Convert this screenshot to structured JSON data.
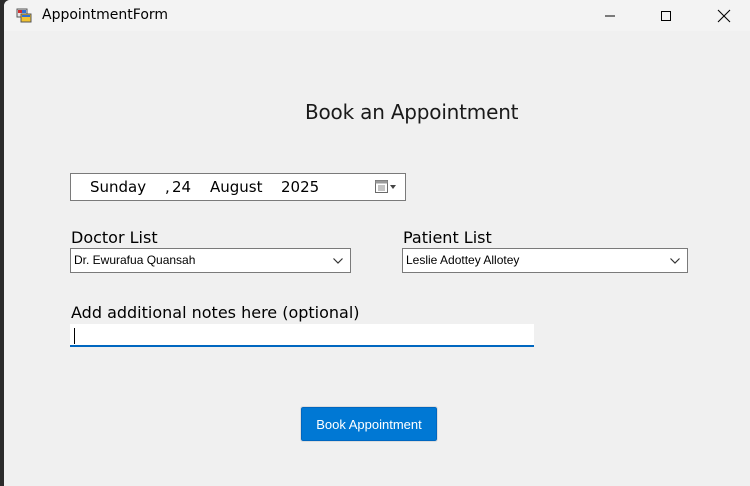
{
  "window": {
    "title": "AppointmentForm",
    "controls": {
      "minimize": "minimize-icon",
      "maximize": "maximize-icon",
      "close": "close-icon"
    }
  },
  "form": {
    "heading": "Book an Appointment",
    "date": {
      "weekday": "Sunday",
      "separator": ",",
      "day": "24",
      "month": "August",
      "year": "2025"
    },
    "doctor": {
      "label": "Doctor List",
      "selected": "Dr. Ewurafua Quansah"
    },
    "patient": {
      "label": "Patient List",
      "selected": "Leslie Adottey Allotey"
    },
    "notes": {
      "label": "Add additional notes here (optional)",
      "value": ""
    },
    "submit_label": "Book Appointment"
  },
  "colors": {
    "accent": "#0078d4",
    "window_bg": "#f0f0f0",
    "border": "#7a7a7a"
  }
}
